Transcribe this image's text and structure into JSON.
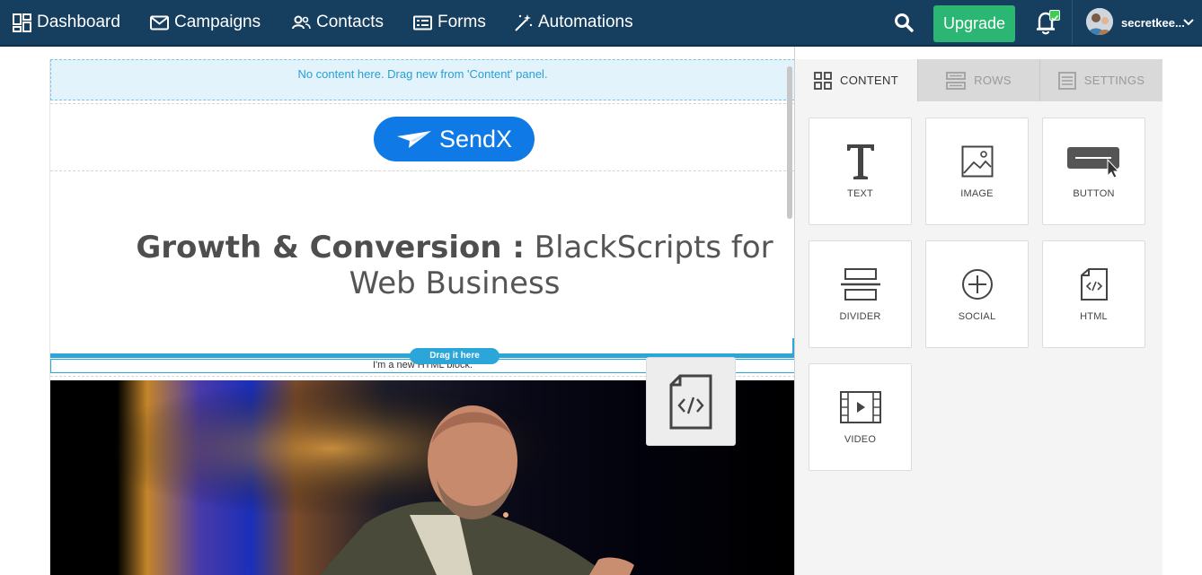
{
  "nav": {
    "items": [
      {
        "label": "Dashboard",
        "icon": "dashboard-icon"
      },
      {
        "label": "Campaigns",
        "icon": "envelope-icon"
      },
      {
        "label": "Contacts",
        "icon": "users-icon"
      },
      {
        "label": "Forms",
        "icon": "form-icon"
      },
      {
        "label": "Automations",
        "icon": "magic-wand-icon"
      }
    ],
    "upgrade_label": "Upgrade",
    "username": "secretkee...",
    "colors": {
      "bar": "#163e5f",
      "upgrade": "#2bb673",
      "badge": "#3ecf52"
    }
  },
  "canvas": {
    "empty_row_text": "No content here. Drag new from 'Content' panel.",
    "logo_text": "SendX",
    "heading_bold": "Growth & Conversion :",
    "heading_rest": " BlackScripts for Web Business",
    "drag_tag": "Drag it here",
    "html_block_text": "I'm a new HTML block."
  },
  "panel": {
    "tabs": [
      {
        "label": "CONTENT",
        "icon": "grid-icon",
        "active": true
      },
      {
        "label": "ROWS",
        "icon": "rows-icon",
        "active": false
      },
      {
        "label": "SETTINGS",
        "icon": "settings-list-icon",
        "active": false
      }
    ],
    "tiles": [
      {
        "label": "TEXT",
        "icon": "text-icon"
      },
      {
        "label": "IMAGE",
        "icon": "image-icon"
      },
      {
        "label": "BUTTON",
        "icon": "button-icon"
      },
      {
        "label": "DIVIDER",
        "icon": "divider-icon"
      },
      {
        "label": "SOCIAL",
        "icon": "social-icon"
      },
      {
        "label": "HTML",
        "icon": "html-file-icon"
      },
      {
        "label": "VIDEO",
        "icon": "video-icon"
      }
    ]
  }
}
